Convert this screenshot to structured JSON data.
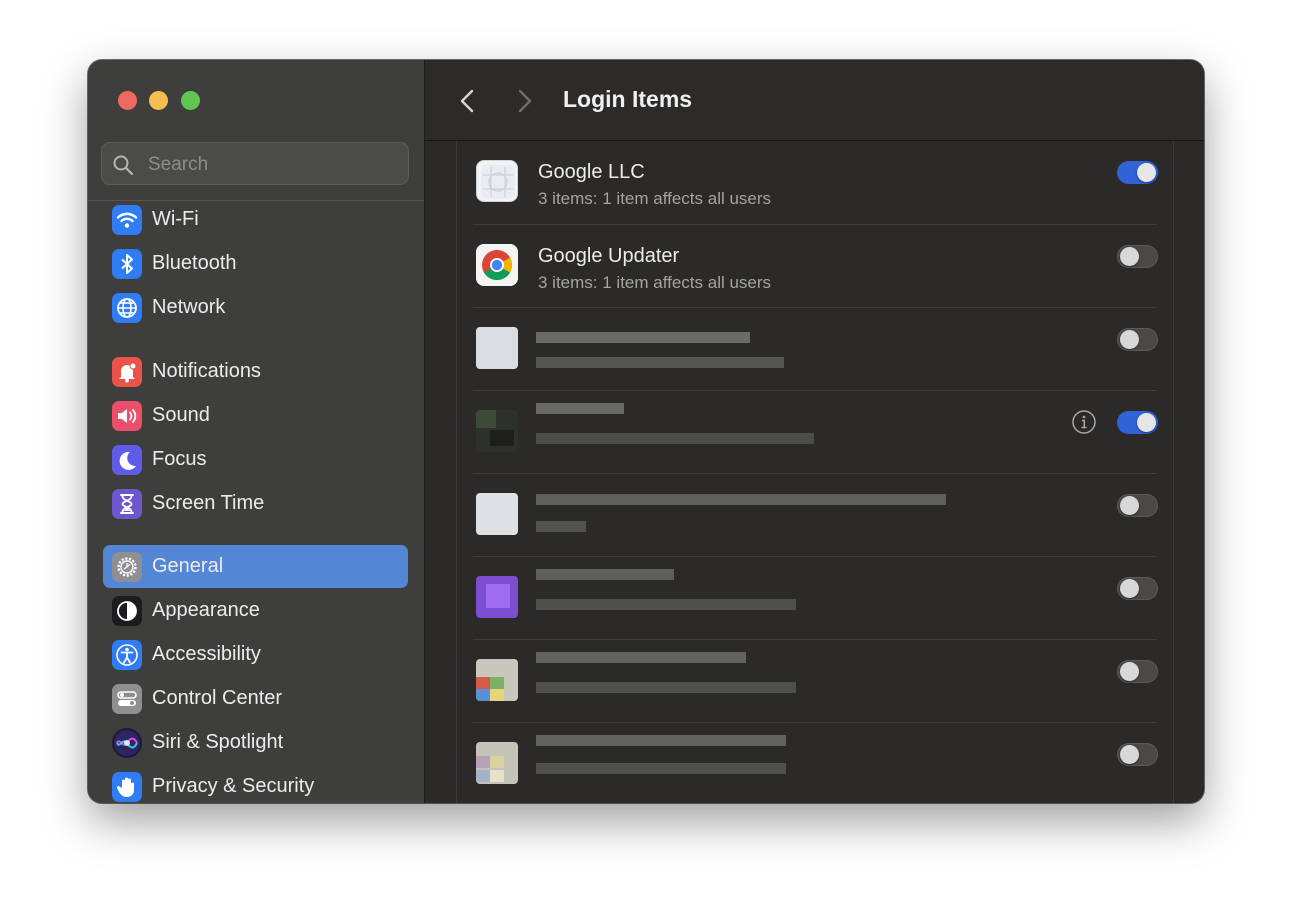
{
  "window": {
    "title": "Login Items"
  },
  "colors": {
    "sidebar_bg": "#3e3e3d",
    "main_bg": "#2b2a28",
    "selection": "#5486d6",
    "toggle_on": "#2f63d6"
  },
  "search": {
    "placeholder": "Search",
    "value": ""
  },
  "sidebar": {
    "items": [
      {
        "label": "Wi-Fi",
        "icon": "wifi-icon",
        "color": "#2f7cf6"
      },
      {
        "label": "Bluetooth",
        "icon": "bluetooth-icon",
        "color": "#2f7cf6"
      },
      {
        "label": "Network",
        "icon": "globe-icon",
        "color": "#2f7cf6"
      },
      {
        "label": "Notifications",
        "icon": "bell-icon",
        "color": "#ec5348"
      },
      {
        "label": "Sound",
        "icon": "speaker-icon",
        "color": "#eb4f6a"
      },
      {
        "label": "Focus",
        "icon": "moon-icon",
        "color": "#5e5ce6"
      },
      {
        "label": "Screen Time",
        "icon": "hourglass-icon",
        "color": "#6e56cf"
      },
      {
        "label": "General",
        "icon": "gear-icon",
        "color": "#8e8e93",
        "selected": true
      },
      {
        "label": "Appearance",
        "icon": "appearance-icon",
        "color": "#1c1c1e"
      },
      {
        "label": "Accessibility",
        "icon": "accessibility-icon",
        "color": "#2f7cf6"
      },
      {
        "label": "Control Center",
        "icon": "control-center-icon",
        "color": "#8e8e93"
      },
      {
        "label": "Siri & Spotlight",
        "icon": "siri-icon",
        "color": "#3a3a8c"
      },
      {
        "label": "Privacy & Security",
        "icon": "hand-icon",
        "color": "#2f7cf6"
      }
    ]
  },
  "toolbar": {
    "back_icon": "chevron-left-icon",
    "forward_icon": "chevron-right-icon"
  },
  "login_items": [
    {
      "title": "Google LLC",
      "subtitle": "3 items: 1 item affects all users",
      "enabled": true,
      "icon": "google-llc-icon"
    },
    {
      "title": "Google Updater",
      "subtitle": "3 items: 1 item affects all users",
      "enabled": false,
      "icon": "chrome-icon"
    },
    {
      "title": "",
      "subtitle": "",
      "enabled": false,
      "redacted": true
    },
    {
      "title": "",
      "subtitle": "",
      "enabled": true,
      "redacted": true,
      "info_button": true
    },
    {
      "title": "",
      "subtitle": "",
      "enabled": false,
      "redacted": true
    },
    {
      "title": "",
      "subtitle": "",
      "enabled": false,
      "redacted": true
    },
    {
      "title": "",
      "subtitle": "",
      "enabled": false,
      "redacted": true
    },
    {
      "title": "",
      "subtitle": "",
      "enabled": false,
      "redacted": true
    }
  ]
}
